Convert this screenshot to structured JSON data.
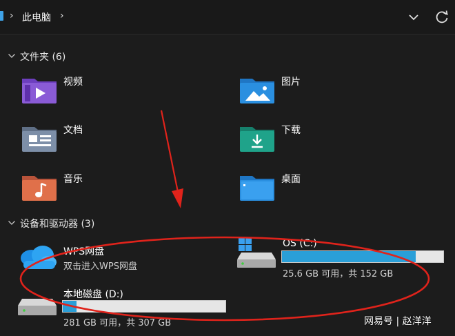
{
  "address_bar": {
    "path": [
      "此电脑"
    ],
    "icons": [
      "this-pc-icon",
      "chevron-right-icon",
      "chevron-down-icon",
      "refresh-icon"
    ]
  },
  "sections": {
    "folders": {
      "title": "文件夹",
      "count": "(6)"
    },
    "devices": {
      "title": "设备和驱动器",
      "count": "(3)"
    }
  },
  "folders": [
    {
      "label": "视频",
      "icon": "videos-folder-icon",
      "color": "#8a5bd6"
    },
    {
      "label": "图片",
      "icon": "pictures-folder-icon",
      "color": "#2a8fe0"
    },
    {
      "label": "文档",
      "icon": "documents-folder-icon",
      "color": "#7d8fa8"
    },
    {
      "label": "下载",
      "icon": "downloads-folder-icon",
      "color": "#1fa38a"
    },
    {
      "label": "音乐",
      "icon": "music-folder-icon",
      "color": "#e0704a"
    },
    {
      "label": "桌面",
      "icon": "desktop-folder-icon",
      "color": "#2a8fe0"
    }
  ],
  "drives": {
    "wps": {
      "name": "WPS网盘",
      "subtitle": "双击进入WPS网盘",
      "icon": "cloud-icon"
    },
    "c": {
      "name": "OS (C:)",
      "free": "25.6 GB 可用，共 152 GB",
      "used_fraction": 0.83,
      "icon": "system-drive-icon"
    },
    "d": {
      "name": "本地磁盘 (D:)",
      "free": "281 GB 可用，共 307 GB",
      "used_fraction": 0.085,
      "icon": "local-drive-icon"
    }
  },
  "annotation": {
    "arrow_color": "#e0231b",
    "ellipse_color": "#e0231b"
  },
  "watermark": "网易号 | 赵洋洋"
}
